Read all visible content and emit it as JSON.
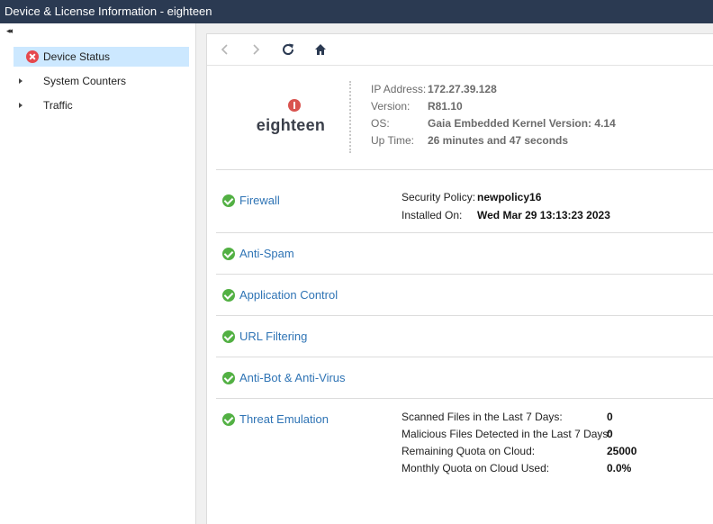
{
  "window": {
    "title": "Device & License Information - eighteen"
  },
  "sidebar": {
    "collapse_icon": "double-chevron-left-icon",
    "items": [
      {
        "label": "Device Status",
        "icon": "error-circle-icon",
        "active": true
      },
      {
        "label": "System Counters",
        "icon": "caret-right-icon",
        "active": false
      },
      {
        "label": "Traffic",
        "icon": "caret-right-icon",
        "active": false
      }
    ]
  },
  "toolbar": {
    "back_icon": "chevron-left-icon",
    "forward_icon": "chevron-right-icon",
    "refresh_icon": "refresh-icon",
    "home_icon": "home-icon"
  },
  "device": {
    "name": "eighteen",
    "ip_label": "IP Address:",
    "ip_value": "172.27.39.128",
    "version_label": "Version:",
    "version_value": "R81.10",
    "os_label": "OS:",
    "os_value": "Gaia Embedded Kernel Version: 4.14",
    "uptime_label": "Up Time:",
    "uptime_value": "26 minutes and 47 seconds"
  },
  "blades": {
    "firewall": {
      "name": "Firewall",
      "policy_label": "Security Policy:",
      "policy_value": "newpolicy16",
      "installed_label": "Installed On:",
      "installed_value": "Wed Mar 29 13:13:23 2023"
    },
    "anti_spam": {
      "name": "Anti-Spam"
    },
    "app_control": {
      "name": "Application Control"
    },
    "url_filtering": {
      "name": "URL Filtering"
    },
    "anti_bot": {
      "name": "Anti-Bot & Anti-Virus"
    },
    "threat_emulation": {
      "name": "Threat Emulation",
      "scanned_label": "Scanned Files in the Last 7 Days:",
      "scanned_value": "0",
      "malicious_label": "Malicious Files Detected in the Last 7 Days:",
      "malicious_value": "0",
      "remaining_label": "Remaining Quota on Cloud:",
      "remaining_value": "25000",
      "monthly_label": "Monthly Quota on Cloud Used:",
      "monthly_value": "0.0%"
    }
  },
  "colors": {
    "titlebar": "#2b3a52",
    "active_item": "#cce8ff",
    "link": "#2f74b5",
    "ok": "#52b043",
    "error": "#e5484d"
  }
}
